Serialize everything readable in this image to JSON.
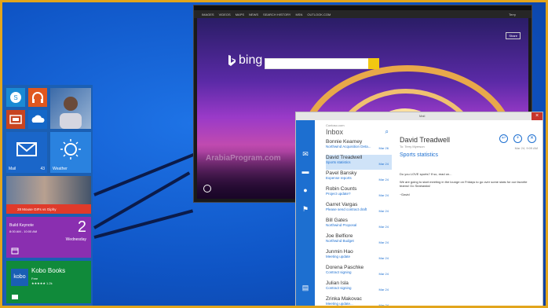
{
  "start": {
    "tiles": [
      {
        "id": "skype",
        "icon": "skype-icon",
        "color": "#1a8ad4"
      },
      {
        "id": "music",
        "icon": "headphones-icon",
        "color": "#e0571e"
      },
      {
        "id": "photo",
        "icon": "photo-icon",
        "color": "#c84420"
      },
      {
        "id": "onedrive",
        "icon": "cloud-icon",
        "color": "#1467c8"
      }
    ],
    "mail_tile": {
      "label": "Mail",
      "count": "43"
    },
    "weather_tile": {
      "label": "Weather"
    },
    "news_tile": {
      "text": "28 Mouse GIFs vs Giphy"
    },
    "calendar_tile": {
      "person": "Build Keynote",
      "time": "8:00 AM - 10:00 AM",
      "day": "2",
      "weekday": "Wednesday"
    },
    "store_tile": {
      "title": "Kobo Books",
      "sub": "Free",
      "rating": "★★★★★ 1.2k",
      "logo": "kobo"
    }
  },
  "browser": {
    "toolbar": [
      "IMAGES",
      "VIDEOS",
      "MAPS",
      "NEWS",
      "SEARCH HISTORY",
      "MSN",
      "OUTLOOK.COM"
    ],
    "user": "Terry",
    "bing_logo": "bing",
    "search_placeholder": "",
    "share_label": "Share"
  },
  "mail": {
    "window_title": "Mail",
    "account": "Contoso.com",
    "folder": "Inbox",
    "messages": [
      {
        "name": "Bonnie Kearney",
        "subject": "Northwind Acquisition Deta...",
        "date": "Mar 26"
      },
      {
        "name": "David Treadwell",
        "subject": "Sports statistics",
        "date": "Mar 24"
      },
      {
        "name": "Pavel Bansky",
        "subject": "Expense reports",
        "date": "Mar 24"
      },
      {
        "name": "Robin Counts",
        "subject": "Project update?",
        "date": "Mar 24"
      },
      {
        "name": "Garret Vargas",
        "subject": "Please send contract draft",
        "date": "Mar 24"
      },
      {
        "name": "Bill Gates",
        "subject": "Northwind Proposal",
        "date": "Mar 24"
      },
      {
        "name": "Joe Belfiore",
        "subject": "Northwind Budget",
        "date": "Mar 24"
      },
      {
        "name": "Junmin Hao",
        "subject": "Meeting update",
        "date": "Mar 24"
      },
      {
        "name": "Dorena Paschke",
        "subject": "Contract signing",
        "date": "Mar 24"
      },
      {
        "name": "Julian Isla",
        "subject": "Contract signing",
        "date": "Mar 24"
      },
      {
        "name": "Zrinka Makovac",
        "subject": "Meeting update...",
        "date": "Mar 24"
      }
    ],
    "reading": {
      "from": "David Treadwell",
      "to": "To: Terry Myerson",
      "date": "Mar 24, 9:09 AM",
      "subject": "Sports statistics",
      "body1": "Do you LOVE sports? If so, read on...",
      "body2": "We are going to start meeting in the lounge on Fridays to go over some stats for our favorite teams! Go Seahawks!",
      "sign": "~David"
    }
  },
  "watermark": "ArabiaProgram.com"
}
